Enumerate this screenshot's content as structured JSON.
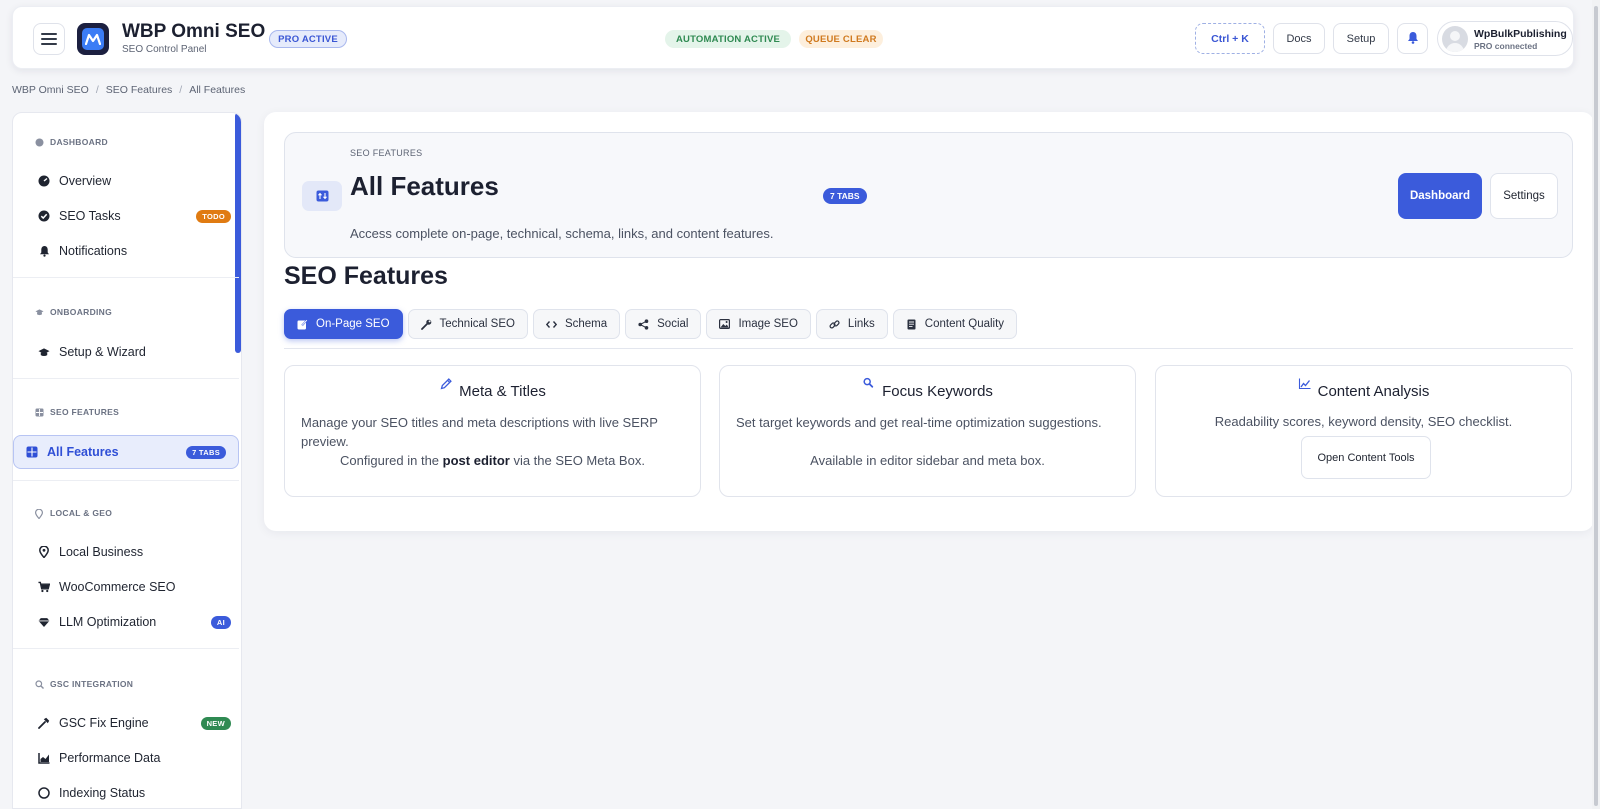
{
  "header": {
    "app_title": "WBP Omni SEO",
    "app_subtitle": "SEO Control Panel",
    "pro_badge": "PRO ACTIVE",
    "status_automation": "AUTOMATION ACTIVE",
    "status_queue": "QUEUE CLEAR",
    "shortcut_label": "Ctrl + K",
    "docs_label": "Docs",
    "setup_label": "Setup",
    "user_name": "WpBulkPublishing",
    "user_status": "PRO connected",
    "icons": [
      "hamburger-icon",
      "app-logo",
      "bell-icon",
      "avatar-icon"
    ]
  },
  "breadcrumb": [
    "WBP Omni SEO",
    "SEO Features",
    "All Features"
  ],
  "sidebar": {
    "sections": [
      {
        "title": "DASHBOARD",
        "icon": "dashboard-icon"
      },
      {
        "title": "ONBOARDING",
        "icon": "graduation-cap-icon"
      },
      {
        "title": "SEO FEATURES",
        "icon": "grid-icon"
      },
      {
        "title": "LOCAL & GEO",
        "icon": "location-pin-icon"
      },
      {
        "title": "GSC INTEGRATION",
        "icon": "search-icon"
      }
    ],
    "items": [
      {
        "label": "Overview",
        "icon": "dashboard-icon"
      },
      {
        "label": "SEO Tasks",
        "icon": "check-circle-icon",
        "badge": "TODO"
      },
      {
        "label": "Notifications",
        "icon": "bell-icon"
      },
      {
        "label": "Setup & Wizard",
        "icon": "graduation-cap-icon"
      },
      {
        "label": "All Features",
        "icon": "grid-icon",
        "badge": "7 TABS",
        "active": true
      },
      {
        "label": "Local Business",
        "icon": "location-pin-icon"
      },
      {
        "label": "WooCommerce SEO",
        "icon": "cart-icon"
      },
      {
        "label": "LLM Optimization",
        "icon": "diamond-icon",
        "badge": "AI"
      },
      {
        "label": "GSC Fix Engine",
        "icon": "hammer-icon",
        "badge": "NEW"
      },
      {
        "label": "Performance Data",
        "icon": "chart-icon"
      },
      {
        "label": "Indexing Status",
        "icon": "index-icon"
      }
    ]
  },
  "hero": {
    "kicker": "SEO FEATURES",
    "title": "All Features",
    "tabs_pill": "7 TABS",
    "description": "Access complete on-page, technical, schema, links, and content features.",
    "dashboard_button": "Dashboard",
    "settings_button": "Settings"
  },
  "features": {
    "section_title": "SEO Features",
    "tabs": [
      {
        "label": "On-Page SEO",
        "icon": "edit-icon",
        "active": true
      },
      {
        "label": "Technical SEO",
        "icon": "wrench-icon"
      },
      {
        "label": "Schema",
        "icon": "code-icon"
      },
      {
        "label": "Social",
        "icon": "share-icon"
      },
      {
        "label": "Image SEO",
        "icon": "image-icon"
      },
      {
        "label": "Links",
        "icon": "link-icon"
      },
      {
        "label": "Content Quality",
        "icon": "document-icon"
      }
    ],
    "cards": [
      {
        "title": "Meta & Titles",
        "icon": "pencil-icon",
        "description": "Manage your SEO titles and meta descriptions with live SERP preview.",
        "note_prefix": "Configured in the ",
        "note_bold": "post editor",
        "note_suffix": " via the SEO Meta Box."
      },
      {
        "title": "Focus Keywords",
        "icon": "search-icon",
        "description": "Set target keywords and get real-time optimization suggestions.",
        "note": "Available in editor sidebar and meta box."
      },
      {
        "title": "Content Analysis",
        "icon": "chart-line-icon",
        "description": "Readability scores, keyword density, SEO checklist.",
        "button": "Open Content Tools"
      }
    ]
  },
  "colors": {
    "accent": "#3b5bdb",
    "todo_badge": "#e07b12",
    "ai_badge": "#3b5bdb",
    "new_badge": "#2f8a52"
  }
}
